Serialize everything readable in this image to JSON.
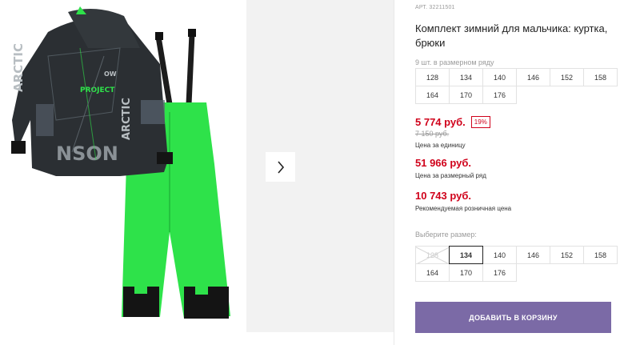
{
  "product": {
    "article": "АРТ. 32211501",
    "title": "Комплект зимний для мальчика: куртка, брюки",
    "quantity_note": "9 шт. в размерном ряду"
  },
  "size_row_reference": [
    "128",
    "134",
    "140",
    "146",
    "152",
    "158",
    "164",
    "170",
    "176"
  ],
  "pricing": {
    "unit_price": "5 774 руб.",
    "discount": "19%",
    "old_price": "7 150 руб.",
    "unit_label": "Цена за единицу",
    "row_price": "51 966 руб.",
    "row_label": "Цена за размерный ряд",
    "rrp_price": "10 743 руб.",
    "rrp_label": "Рекомендуемая розничная цена"
  },
  "size_select": {
    "label": "Выберите размер:",
    "options": [
      "128",
      "134",
      "140",
      "146",
      "152",
      "158",
      "164",
      "170",
      "176"
    ],
    "selected": "134",
    "unavailable": [
      "128"
    ]
  },
  "cart": {
    "button_label": "ДОБАВИТЬ В КОРЗИНУ"
  },
  "image_text": {
    "jacket_print": [
      "ARCTIC",
      "PROJECT",
      "ARCTIC",
      "NSON",
      "OW"
    ]
  },
  "icons": {
    "next": "chevron-right-icon"
  },
  "colors": {
    "price_red": "#d0021b",
    "cart_button": "#7b6aa6",
    "pants_green": "#2ee24a",
    "jacket_dark": "#2b2f33"
  }
}
